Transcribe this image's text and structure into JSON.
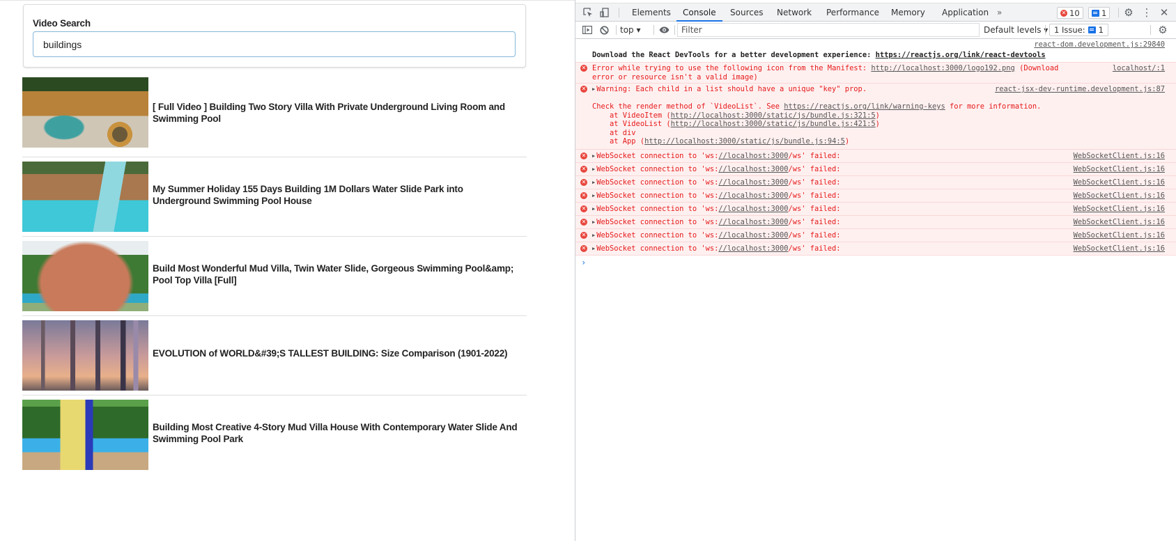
{
  "app": {
    "search": {
      "label": "Video Search",
      "value": "buildings"
    },
    "videos": [
      {
        "title": "[ Full Video ] Building Two Story Villa With Private Underground Living Room and Swimming Pool",
        "thumbnail": "villa-pool-thumbnail"
      },
      {
        "title": "My Summer Holiday 155 Days Building 1M Dollars Water Slide Park into Underground Swimming Pool House",
        "thumbnail": "water-slide-park-thumbnail"
      },
      {
        "title": "Build Most Wonderful Mud Villa, Twin Water Slide, Gorgeous Swimming Pool&amp; Pool Top Villa [Full]",
        "thumbnail": "mud-villa-thumbnail"
      },
      {
        "title": "EVOLUTION of WORLD&#39;S TALLEST BUILDING: Size Comparison (1901-2022)",
        "thumbnail": "tallest-buildings-thumbnail"
      },
      {
        "title": "Building Most Creative 4-Story Mud Villa House With Contemporary Water Slide And Swimming Pool Park",
        "thumbnail": "four-story-villa-thumbnail"
      }
    ]
  },
  "devtools": {
    "tabs": [
      "Elements",
      "Console",
      "Sources",
      "Network",
      "Performance",
      "Memory",
      "Application"
    ],
    "active_tab": "Console",
    "more_tabs": "»",
    "error_count": "10",
    "message_count": "1",
    "context": "top ▾",
    "filter_placeholder": "Filter",
    "levels": "Default levels ▾",
    "issues_label": "1 Issue:",
    "issues_count": "1",
    "colors": {
      "accent": "#1a73e8",
      "error": "#e51919",
      "error_bg": "#fff0f0"
    },
    "messages": {
      "devtools_info": {
        "text": "Download the React DevTools for a better development experience: ",
        "link": "https://reactjs.org/link/react-devtools",
        "source": "react-dom.development.js:29840"
      },
      "manifest_error": {
        "text1": "Error while trying to use the following icon from the Manifest: ",
        "link": "http://localhost:3000/logo192.png",
        "text2": " (Download",
        "text3": "error or resource isn't a valid image)",
        "source": "localhost/:1"
      },
      "key_warning": {
        "text": "Warning: Each child in a list should have a unique \"key\" prop.",
        "source": "react-jsx-dev-runtime.development.js:87",
        "check_pre": "Check the render method of `VideoList`. See ",
        "check_link": "https://reactjs.org/link/warning-keys",
        "check_post": " for more information.",
        "stack": [
          {
            "pre": "    at VideoItem (",
            "link": "http://localhost:3000/static/js/bundle.js:321:5",
            "post": ")"
          },
          {
            "pre": "    at VideoList (",
            "link": "http://localhost:3000/static/js/bundle.js:421:5",
            "post": ")"
          },
          {
            "pre": "    at div",
            "link": "",
            "post": ""
          },
          {
            "pre": "    at App (",
            "link": "http://localhost:3000/static/js/bundle.js:94:5",
            "post": ")"
          }
        ]
      },
      "websocket_errors": [
        {
          "pre": "WebSocket connection to 'ws:",
          "link": "//localhost:3000",
          "post": "/ws' failed:",
          "source": "WebSocketClient.js:16"
        },
        {
          "pre": "WebSocket connection to 'ws:",
          "link": "//localhost:3000",
          "post": "/ws' failed:",
          "source": "WebSocketClient.js:16"
        },
        {
          "pre": "WebSocket connection to 'ws:",
          "link": "//localhost:3000",
          "post": "/ws' failed:",
          "source": "WebSocketClient.js:16"
        },
        {
          "pre": "WebSocket connection to 'ws:",
          "link": "//localhost:3000",
          "post": "/ws' failed:",
          "source": "WebSocketClient.js:16"
        },
        {
          "pre": "WebSocket connection to 'ws:",
          "link": "//localhost:3000",
          "post": "/ws' failed:",
          "source": "WebSocketClient.js:16"
        },
        {
          "pre": "WebSocket connection to 'ws:",
          "link": "//localhost:3000",
          "post": "/ws' failed:",
          "source": "WebSocketClient.js:16"
        },
        {
          "pre": "WebSocket connection to 'ws:",
          "link": "//localhost:3000",
          "post": "/ws' failed:",
          "source": "WebSocketClient.js:16"
        },
        {
          "pre": "WebSocket connection to 'ws:",
          "link": "//localhost:3000",
          "post": "/ws' failed:",
          "source": "WebSocketClient.js:16"
        }
      ],
      "prompt": "›"
    }
  }
}
